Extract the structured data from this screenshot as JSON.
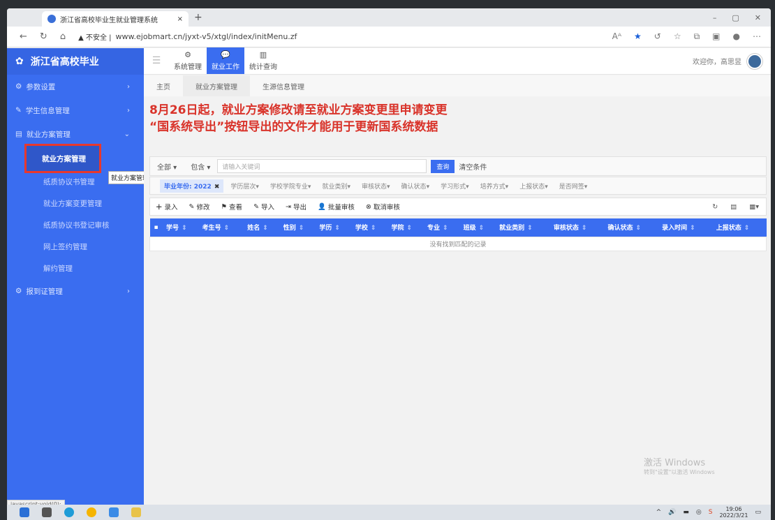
{
  "browser": {
    "tab_title": "浙江省高校毕业生就业管理系统",
    "security_label": "不安全",
    "url": "www.ejobmart.cn/jyxt-v5/xtgl/index/initMenu.zf",
    "status_url": "javascript:void(0);"
  },
  "sidebar": {
    "logo_text": "浙江省高校毕业",
    "items": [
      {
        "label": "参数设置"
      },
      {
        "label": "学生信息管理"
      },
      {
        "label": "就业方案管理"
      },
      {
        "label": "报到证管理"
      }
    ],
    "subitems": [
      {
        "label": "就业方案管理"
      },
      {
        "label": "纸质协议书管理"
      },
      {
        "label": "就业方案变更管理"
      },
      {
        "label": "纸质协议书登记审核"
      },
      {
        "label": "网上签约管理"
      },
      {
        "label": "解约管理"
      }
    ],
    "tooltip": "就业方案管理"
  },
  "topnav": {
    "items": [
      {
        "label": "系统管理"
      },
      {
        "label": "就业工作"
      },
      {
        "label": "统计查询"
      }
    ],
    "welcome": "欢迎你，高思昱"
  },
  "breadcrumbs": [
    "主页",
    "就业方案管理",
    "生源信息管理"
  ],
  "notice": {
    "line1": "8月26日起，就业方案修改请至就业方案变更里申请变更",
    "line2": "“国系统导出”按钮导出的文件才能用于更新国系统数据"
  },
  "search": {
    "scope": "全部",
    "mode": "包含",
    "placeholder": "请输入关键词",
    "query_btn": "查询",
    "clear_btn": "清空条件"
  },
  "filters": {
    "chip_label": "毕业年份",
    "chip_value": "2022",
    "items": [
      "学历层次",
      "学校学院专业",
      "就业类别",
      "审核状态",
      "确认状态",
      "学习形式",
      "培养方式",
      "上报状态",
      "是否网签"
    ]
  },
  "toolbar": {
    "buttons": [
      "录入",
      "修改",
      "查看",
      "导入",
      "导出",
      "批量审核",
      "取消审核"
    ]
  },
  "table": {
    "columns": [
      "学号",
      "考生号",
      "姓名",
      "性别",
      "学历",
      "学校",
      "学院",
      "专业",
      "班级",
      "就业类别",
      "审核状态",
      "确认状态",
      "录入时间",
      "上报状态"
    ],
    "empty_text": "没有找到匹配的记录"
  },
  "watermark": {
    "line1": "激活 Windows",
    "line2": "转到\"设置\"以激活 Windows"
  },
  "clock": {
    "time": "19:06",
    "date": "2022/3/21"
  },
  "colors": {
    "primary": "#3a6df0",
    "notice": "#d9332a",
    "highlight_box": "#e8382d"
  }
}
